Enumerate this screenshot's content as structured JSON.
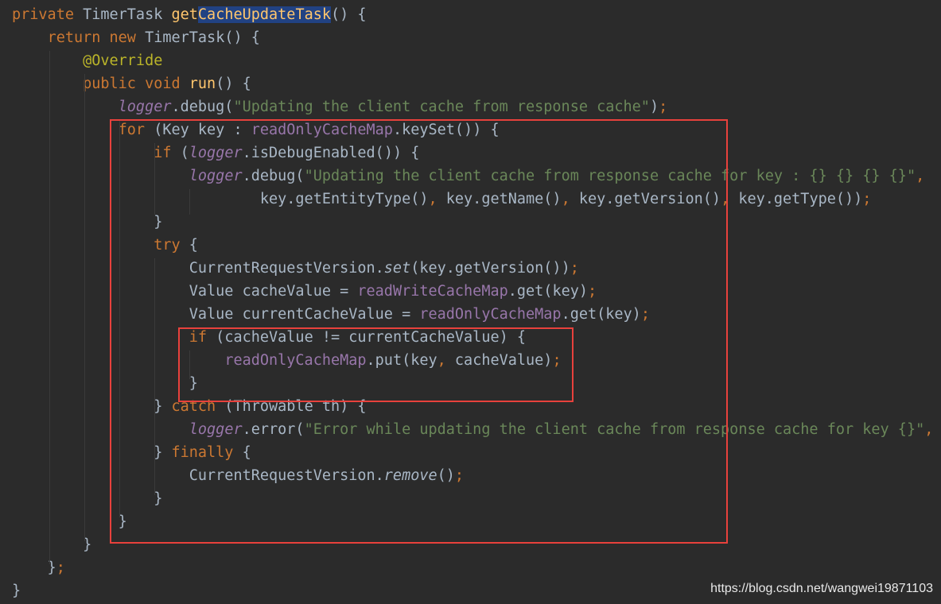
{
  "watermark": "https://blog.csdn.net/wangwei19871103",
  "code_lines": [
    "private TimerTask getCacheUpdateTask() {",
    "    return new TimerTask() {",
    "        @Override",
    "        public void run() {",
    "            logger.debug(\"Updating the client cache from response cache\");",
    "            for (Key key : readOnlyCacheMap.keySet()) {",
    "                if (logger.isDebugEnabled()) {",
    "                    logger.debug(\"Updating the client cache from response cache for key : {} {} {} {}\",",
    "                            key.getEntityType(), key.getName(), key.getVersion(), key.getType());",
    "                }",
    "                try {",
    "                    CurrentRequestVersion.set(key.getVersion());",
    "                    Value cacheValue = readWriteCacheMap.get(key);",
    "                    Value currentCacheValue = readOnlyCacheMap.get(key);",
    "                    if (cacheValue != currentCacheValue) {",
    "                        readOnlyCacheMap.put(key, cacheValue);",
    "                    }",
    "                } catch (Throwable th) {",
    "                    logger.error(\"Error while updating the client cache from response cache for key {}\", key",
    "                } finally {",
    "                    CurrentRequestVersion.remove();",
    "                }",
    "            }",
    "        }",
    "    };",
    "}"
  ],
  "highlights": [
    "for-loop-block",
    "if-cache-compare-block"
  ],
  "colors": {
    "background": "#2b2b2b",
    "text": "#a9b7c6",
    "keyword": "#cc7832",
    "method": "#ffc66d",
    "field": "#9876aa",
    "string": "#6a8759",
    "annotation": "#bbb529",
    "highlight_box": "#e8413c"
  }
}
